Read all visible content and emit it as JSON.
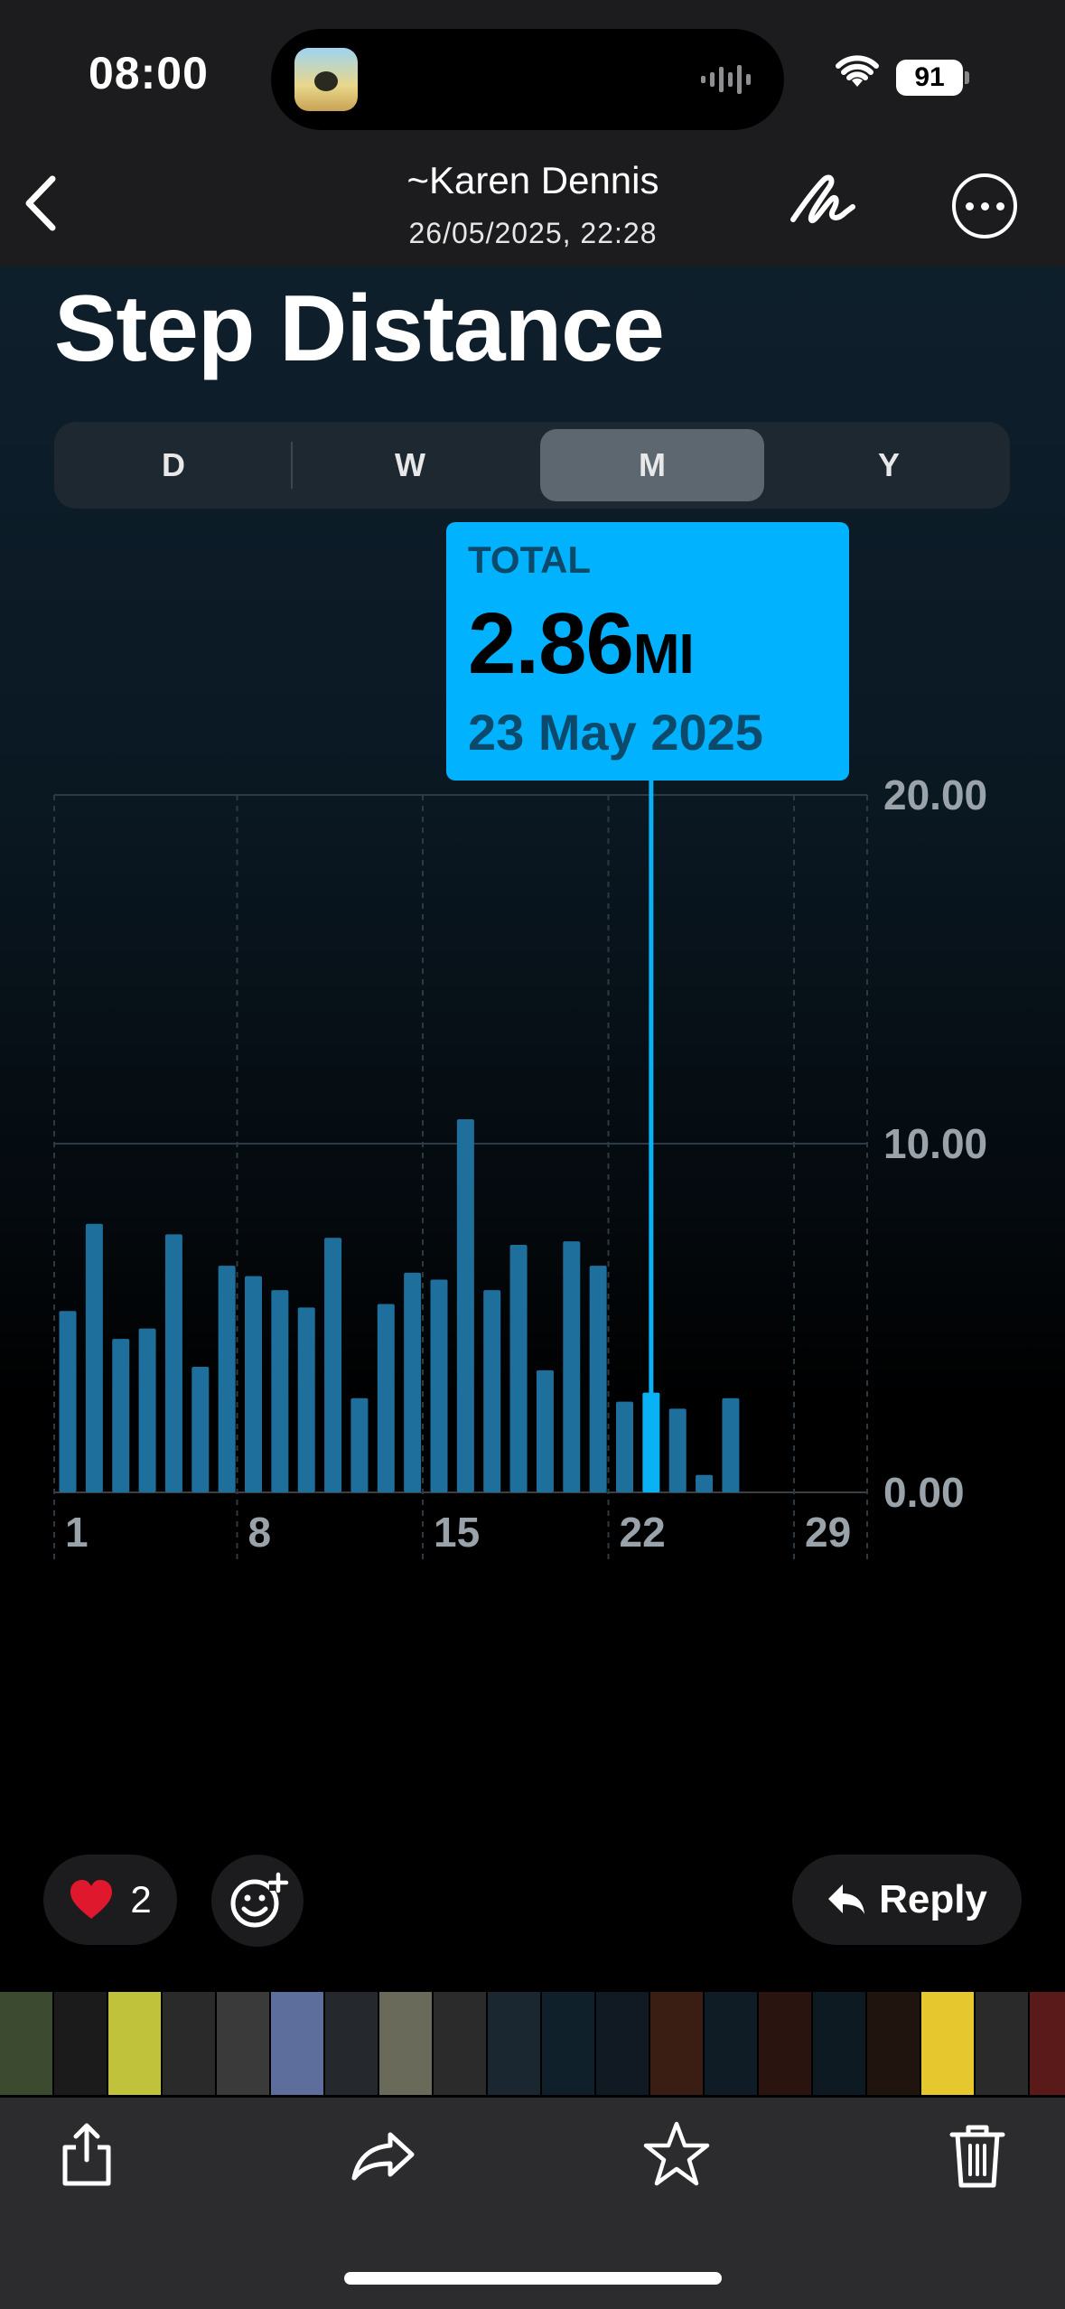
{
  "status_bar": {
    "time": "08:00",
    "battery": "91"
  },
  "header": {
    "sender": "~Karen Dennis",
    "timestamp": "26/05/2025, 22:28"
  },
  "photo": {
    "title": "Step Distance",
    "segments": [
      {
        "label": "D",
        "selected": false
      },
      {
        "label": "W",
        "selected": false
      },
      {
        "label": "M",
        "selected": true
      },
      {
        "label": "Y",
        "selected": false
      }
    ],
    "callout": {
      "label": "TOTAL",
      "value": "2.86",
      "unit": "MI",
      "date": "23 May 2025"
    }
  },
  "chart_data": {
    "type": "bar",
    "title": "Step Distance",
    "units": "MI",
    "x": [
      1,
      2,
      3,
      4,
      5,
      6,
      7,
      8,
      9,
      10,
      11,
      12,
      13,
      14,
      15,
      16,
      17,
      18,
      19,
      20,
      21,
      22,
      23,
      24,
      25,
      26
    ],
    "values": [
      5.2,
      7.7,
      4.4,
      4.7,
      7.4,
      3.6,
      6.5,
      6.2,
      5.8,
      5.3,
      7.3,
      2.7,
      5.4,
      6.3,
      6.1,
      10.7,
      5.8,
      7.1,
      3.5,
      7.2,
      6.5,
      2.6,
      2.86,
      2.4,
      0.5,
      2.7
    ],
    "highlighted_index": 22,
    "ylim": [
      0,
      20
    ],
    "y_ticks": [
      "0.00",
      "10.00",
      "20.00"
    ],
    "x_ticks": [
      "1",
      "8",
      "15",
      "22",
      "29"
    ],
    "color": "#1f6f9c",
    "highlight_color": "#0bb1f5",
    "grid": true
  },
  "reactions": {
    "count": "2",
    "emoji": "heart"
  },
  "reply_label": "Reply",
  "colors": {
    "accent": "#00b2ff",
    "bar": "#1f6f9c",
    "background": "#000000"
  },
  "toolbar": [
    "share-icon",
    "forward-icon",
    "star-icon",
    "trash-icon"
  ]
}
